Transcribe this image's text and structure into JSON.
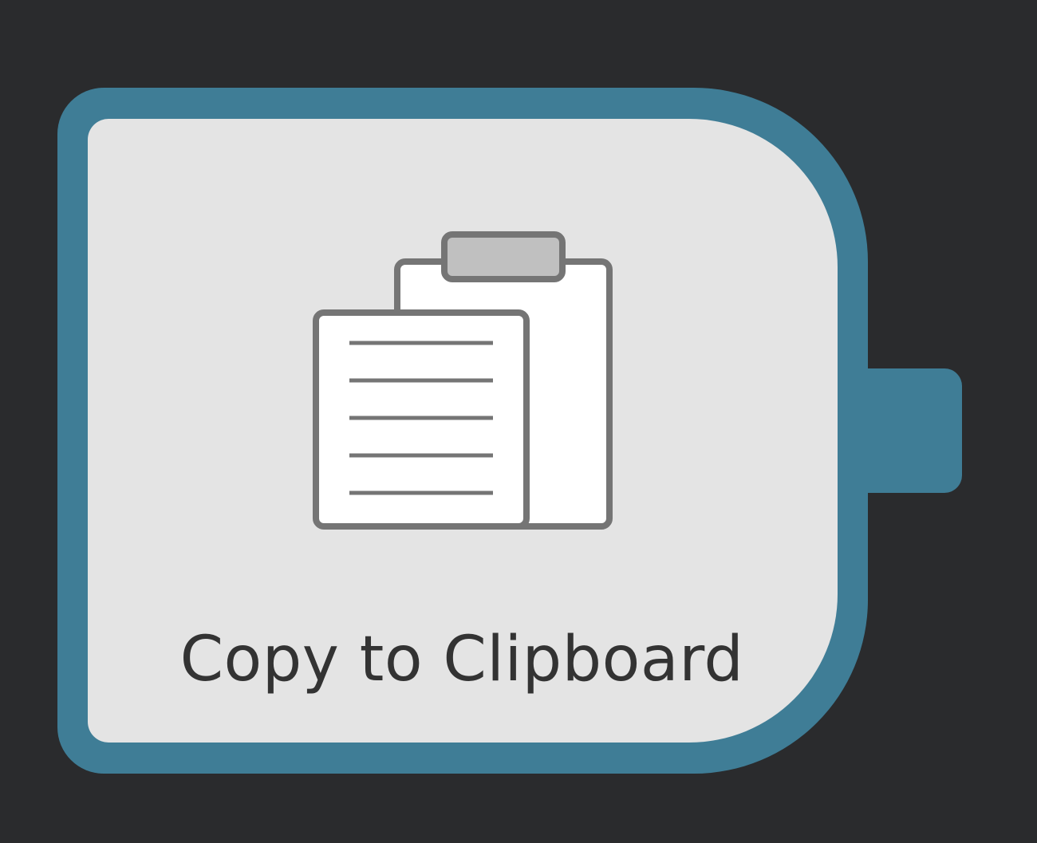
{
  "canvas": {
    "background_color": "#2a2b2d"
  },
  "node": {
    "label": "Copy to Clipboard",
    "icon": "clipboard-icon",
    "border_color": "#3f7d96",
    "fill_color": "#e4e4e4",
    "output_port": "output-port"
  }
}
